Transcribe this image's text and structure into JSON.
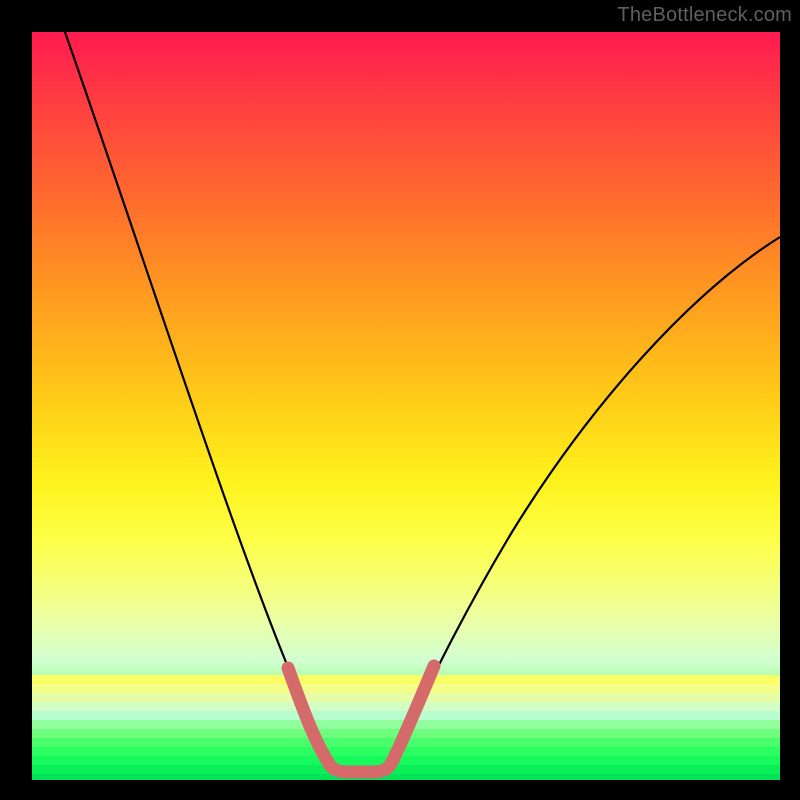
{
  "watermark": {
    "text": "TheBottleneck.com"
  },
  "colors": {
    "frame": "#000000",
    "curve": "#000000",
    "marker": "#d46a6a",
    "gradient_top": "#ff1a50",
    "gradient_bottom": "#00e860"
  },
  "chart_data": {
    "type": "line",
    "title": "",
    "xlabel": "",
    "ylabel": "",
    "xlim": [
      0,
      100
    ],
    "ylim": [
      0,
      100
    ],
    "x": [
      0,
      5,
      10,
      15,
      20,
      25,
      30,
      33,
      36,
      38,
      40,
      42,
      44,
      46,
      48,
      50,
      55,
      60,
      65,
      70,
      75,
      80,
      85,
      90,
      95,
      100
    ],
    "values": [
      100,
      85,
      70,
      56,
      43,
      31,
      20,
      13,
      7,
      4,
      2,
      1,
      1,
      2,
      4,
      7,
      16,
      25,
      33,
      41,
      48,
      55,
      61,
      66,
      70,
      73
    ],
    "notch_region_x": [
      33,
      48
    ],
    "markers_x": [
      33,
      34,
      35,
      36,
      37,
      38,
      39,
      40,
      41,
      42,
      43,
      44,
      45,
      46,
      47,
      48
    ],
    "markers_y": [
      13,
      10,
      8,
      6,
      4.5,
      3.5,
      2.5,
      2,
      1.6,
      1.4,
      1.4,
      1.8,
      2.5,
      3.8,
      5.5,
      8
    ]
  }
}
